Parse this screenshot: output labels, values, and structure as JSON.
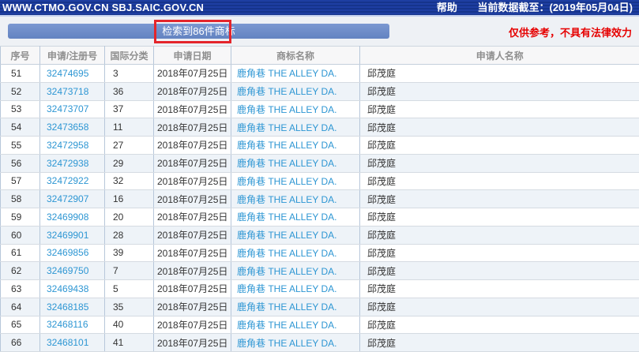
{
  "topbar": {
    "site": "WWW.CTMO.GOV.CN SBJ.SAIC.GOV.CN",
    "help": "帮助",
    "data_date": "当前数据截至：(2019年05月04日)"
  },
  "banner": {
    "result_count": "检索到86件商标",
    "disclaimer": "仅供参考，不具有法律效力",
    "button_color": "#6d8ec9",
    "highlight_box_color": "#e4252b",
    "disclaimer_color": "#e60000",
    "link_color": "#2d96d3",
    "topbar_color": "#16348c"
  },
  "table": {
    "headers": [
      "序号",
      "申请/注册号",
      "国际分类",
      "申请日期",
      "商标名称",
      "申请人名称"
    ],
    "rows": [
      {
        "seq": "51",
        "app_no": "32474695",
        "intl_class": "3",
        "date": "2018年07月25日",
        "mark": "鹿角巷 THE ALLEY DA.",
        "applicant": "邱茂庭"
      },
      {
        "seq": "52",
        "app_no": "32473718",
        "intl_class": "36",
        "date": "2018年07月25日",
        "mark": "鹿角巷 THE ALLEY DA.",
        "applicant": "邱茂庭"
      },
      {
        "seq": "53",
        "app_no": "32473707",
        "intl_class": "37",
        "date": "2018年07月25日",
        "mark": "鹿角巷 THE ALLEY DA.",
        "applicant": "邱茂庭"
      },
      {
        "seq": "54",
        "app_no": "32473658",
        "intl_class": "11",
        "date": "2018年07月25日",
        "mark": "鹿角巷 THE ALLEY DA.",
        "applicant": "邱茂庭"
      },
      {
        "seq": "55",
        "app_no": "32472958",
        "intl_class": "27",
        "date": "2018年07月25日",
        "mark": "鹿角巷 THE ALLEY DA.",
        "applicant": "邱茂庭"
      },
      {
        "seq": "56",
        "app_no": "32472938",
        "intl_class": "29",
        "date": "2018年07月25日",
        "mark": "鹿角巷 THE ALLEY DA.",
        "applicant": "邱茂庭"
      },
      {
        "seq": "57",
        "app_no": "32472922",
        "intl_class": "32",
        "date": "2018年07月25日",
        "mark": "鹿角巷 THE ALLEY DA.",
        "applicant": "邱茂庭"
      },
      {
        "seq": "58",
        "app_no": "32472907",
        "intl_class": "16",
        "date": "2018年07月25日",
        "mark": "鹿角巷 THE ALLEY DA.",
        "applicant": "邱茂庭"
      },
      {
        "seq": "59",
        "app_no": "32469908",
        "intl_class": "20",
        "date": "2018年07月25日",
        "mark": "鹿角巷 THE ALLEY DA.",
        "applicant": "邱茂庭"
      },
      {
        "seq": "60",
        "app_no": "32469901",
        "intl_class": "28",
        "date": "2018年07月25日",
        "mark": "鹿角巷 THE ALLEY DA.",
        "applicant": "邱茂庭"
      },
      {
        "seq": "61",
        "app_no": "32469856",
        "intl_class": "39",
        "date": "2018年07月25日",
        "mark": "鹿角巷 THE ALLEY DA.",
        "applicant": "邱茂庭"
      },
      {
        "seq": "62",
        "app_no": "32469750",
        "intl_class": "7",
        "date": "2018年07月25日",
        "mark": "鹿角巷 THE ALLEY DA.",
        "applicant": "邱茂庭"
      },
      {
        "seq": "63",
        "app_no": "32469438",
        "intl_class": "5",
        "date": "2018年07月25日",
        "mark": "鹿角巷 THE ALLEY DA.",
        "applicant": "邱茂庭"
      },
      {
        "seq": "64",
        "app_no": "32468185",
        "intl_class": "35",
        "date": "2018年07月25日",
        "mark": "鹿角巷 THE ALLEY DA.",
        "applicant": "邱茂庭"
      },
      {
        "seq": "65",
        "app_no": "32468116",
        "intl_class": "40",
        "date": "2018年07月25日",
        "mark": "鹿角巷 THE ALLEY DA.",
        "applicant": "邱茂庭"
      },
      {
        "seq": "66",
        "app_no": "32468101",
        "intl_class": "41",
        "date": "2018年07月25日",
        "mark": "鹿角巷 THE ALLEY DA.",
        "applicant": "邱茂庭"
      }
    ]
  }
}
